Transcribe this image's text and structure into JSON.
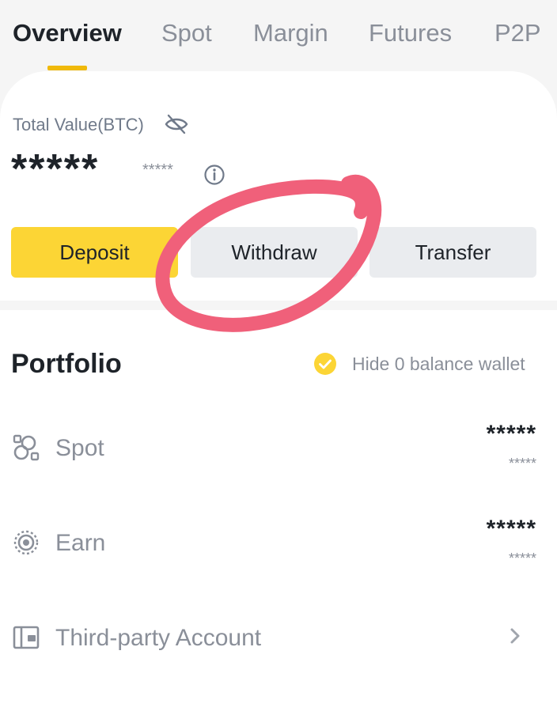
{
  "tabs": [
    {
      "label": "Overview",
      "active": true
    },
    {
      "label": "Spot",
      "active": false
    },
    {
      "label": "Margin",
      "active": false
    },
    {
      "label": "Futures",
      "active": false
    },
    {
      "label": "P2P",
      "active": false
    }
  ],
  "summary": {
    "total_label": "Total Value(BTC)",
    "hidden_value": "*****",
    "hidden_sub_value": "*****",
    "visibility_icon": "eye-slash-icon",
    "info_icon": "info-icon"
  },
  "actions": {
    "deposit": "Deposit",
    "withdraw": "Withdraw",
    "transfer": "Transfer"
  },
  "portfolio": {
    "title": "Portfolio",
    "hide_zero_label": "Hide 0 balance wallet",
    "hide_zero_checked": true,
    "rows": [
      {
        "label": "Spot",
        "value": "*****",
        "sub_value": "*****",
        "icon": "spot-wallet-icon"
      },
      {
        "label": "Earn",
        "value": "*****",
        "sub_value": "*****",
        "icon": "earn-icon"
      },
      {
        "label": "Third-party Account",
        "icon": "wallet-icon",
        "chevron": "chevron-right-icon"
      }
    ]
  },
  "colors": {
    "accent_yellow": "#fcd535",
    "tab_underline": "#f0b90b",
    "annotation_circle": "#f0607a",
    "text_primary": "#1e2329",
    "text_secondary": "#8a8f99",
    "button_gray": "#eaecef"
  }
}
